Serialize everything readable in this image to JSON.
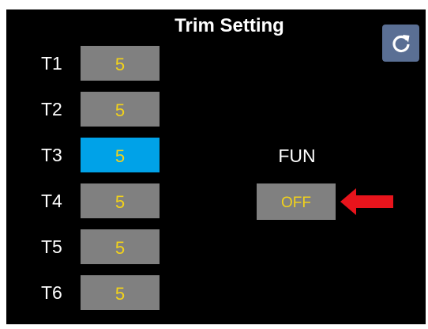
{
  "header": {
    "title": "Trim Setting",
    "reset_icon": "refresh-icon"
  },
  "trims": [
    {
      "label": "T1",
      "value": "5",
      "selected": false
    },
    {
      "label": "T2",
      "value": "5",
      "selected": false
    },
    {
      "label": "T3",
      "value": "5",
      "selected": true
    },
    {
      "label": "T4",
      "value": "5",
      "selected": false
    },
    {
      "label": "T5",
      "value": "5",
      "selected": false
    },
    {
      "label": "T6",
      "value": "5",
      "selected": false
    }
  ],
  "fun": {
    "label": "FUN",
    "value": "OFF",
    "pointer_icon": "arrow-left-icon"
  },
  "colors": {
    "background": "#000000",
    "value_box": "#808080",
    "selected_box": "#00a2e8",
    "value_text": "#f2d21a",
    "reset_button": "#5a6f94",
    "pointer": "#e8141c"
  }
}
